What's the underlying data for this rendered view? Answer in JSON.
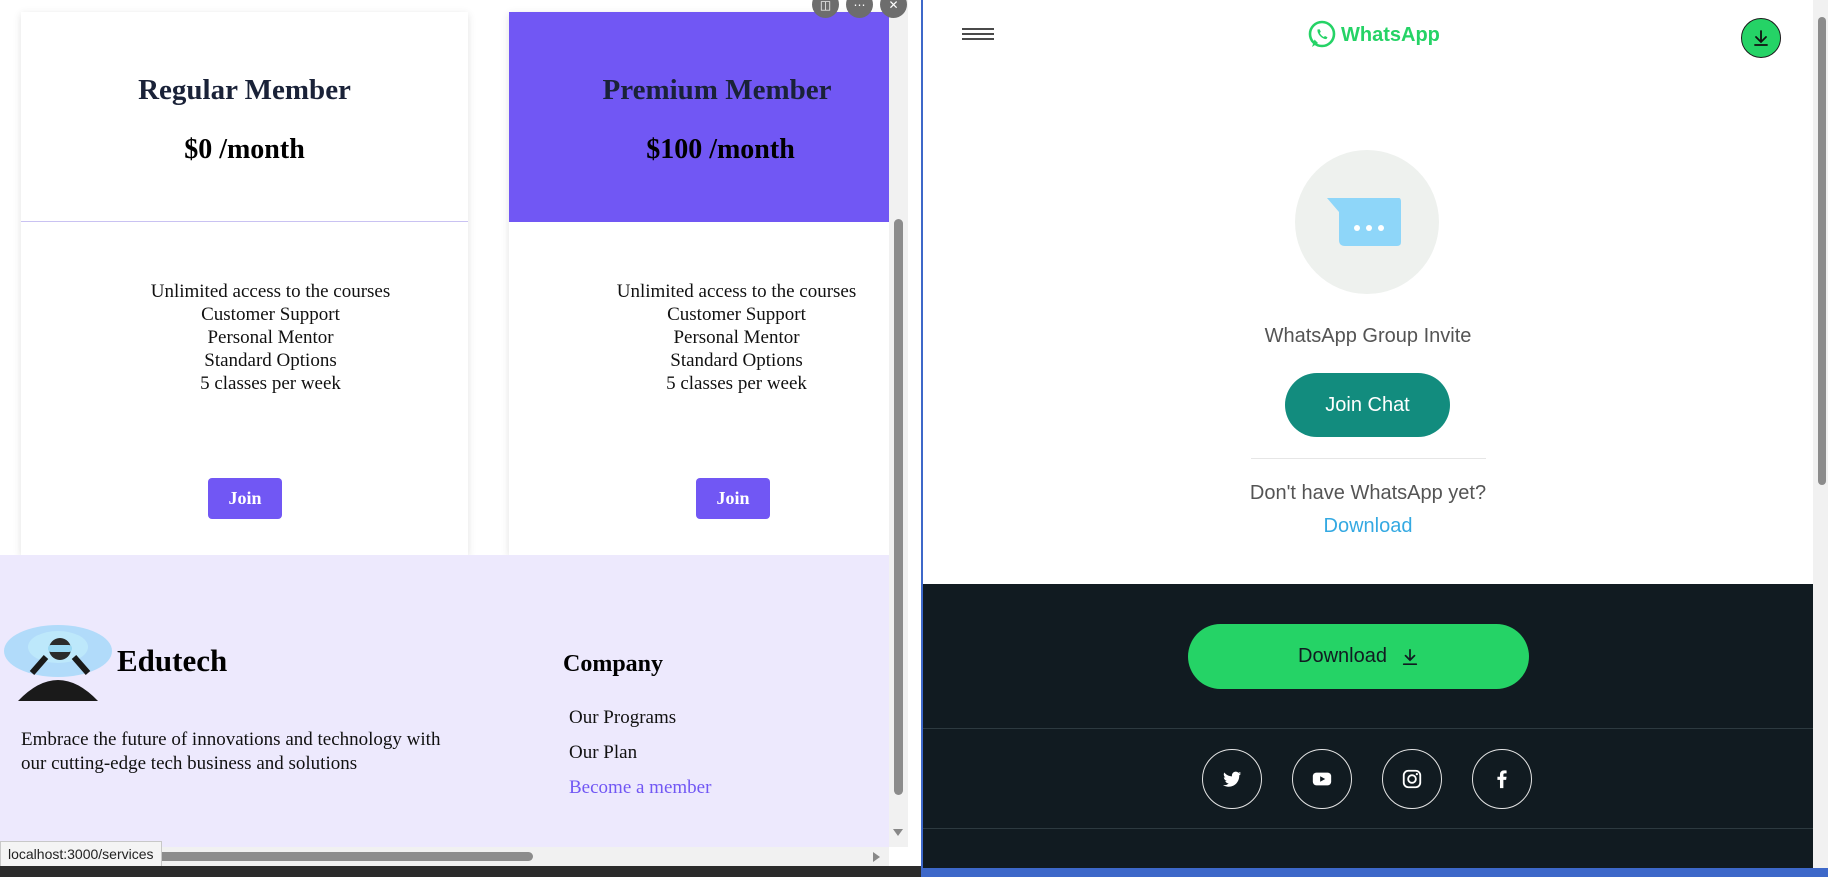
{
  "plans": {
    "regular": {
      "title": "Regular Member",
      "price": "$0 /month",
      "features": [
        "Unlimited access to the courses",
        "Customer Support",
        "Personal Mentor",
        "Standard Options",
        "5 classes per week"
      ],
      "button": "Join"
    },
    "premium": {
      "title": "Premium Member",
      "price": "$100 /month",
      "features": [
        "Unlimited access to the courses",
        "Customer Support",
        "Personal Mentor",
        "Standard Options",
        "5 classes per week"
      ],
      "button": "Join"
    }
  },
  "footer": {
    "brand": "Edutech",
    "tagline": "Embrace the future of innovations and technology with our cutting-edge tech business and solutions",
    "company_heading": "Company",
    "links": [
      "Our Programs",
      "Our Plan",
      "Become a member"
    ]
  },
  "status_bar": {
    "url": "localhost:3000/services"
  },
  "whatsapp": {
    "logo_text": "WhatsApp",
    "invite_title": "WhatsApp Group Invite",
    "join_button": "Join Chat",
    "no_app_text": "Don't have WhatsApp yet?",
    "download_link": "Download",
    "footer_download_button": "Download",
    "social_icons": [
      "twitter-icon",
      "youtube-icon",
      "instagram-icon",
      "facebook-icon"
    ]
  },
  "colors": {
    "accent_purple": "#7157f4",
    "whatsapp_green": "#25d366",
    "whatsapp_teal": "#128c7e",
    "footer_dark": "#111b21",
    "link_blue": "#34a9e2"
  }
}
